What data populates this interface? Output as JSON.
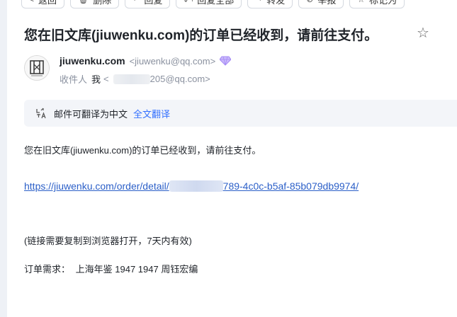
{
  "toolbar": {
    "items": [
      {
        "label": "返回",
        "icon": "back-icon"
      },
      {
        "label": "删除",
        "icon": "trash-icon"
      },
      {
        "label": "回复",
        "icon": "reply-icon"
      },
      {
        "label": "回复全部",
        "icon": "reply-all-icon"
      },
      {
        "label": "转发",
        "icon": "forward-icon"
      },
      {
        "label": "举报",
        "icon": "report-icon"
      },
      {
        "label": "标记为",
        "icon": "star-outline-icon"
      }
    ]
  },
  "email": {
    "subject": "您在旧文库(jiuwenku.com)的订单已经收到，请前往支付。",
    "sender_name": "jiuwenku.com",
    "sender_email": "<jiuwenku@qq.com>",
    "recipient_label": "收件人",
    "recipient_me": "我",
    "recipient_email_prefix": "<",
    "recipient_email_suffix": "205@qq.com>",
    "translate_text": "邮件可翻译为中文",
    "translate_link": "全文翻译",
    "body_line1": "您在旧文库(jiuwenku.com)的订单已经收到，请前往支付。",
    "order_link_prefix": "https://jiuwenku.com/order/detail/",
    "order_link_suffix": "789-4c0c-b5af-85b079db9974/",
    "note": "(链接需要复制到浏览器打开，7天内有效)",
    "order_label": "订单需求：",
    "order_value": "上海年鉴 1947 1947 周钰宏编"
  },
  "colors": {
    "link": "#2b5fc8",
    "translate_link": "#3370ff",
    "vip_badge": "#a58bf5"
  }
}
